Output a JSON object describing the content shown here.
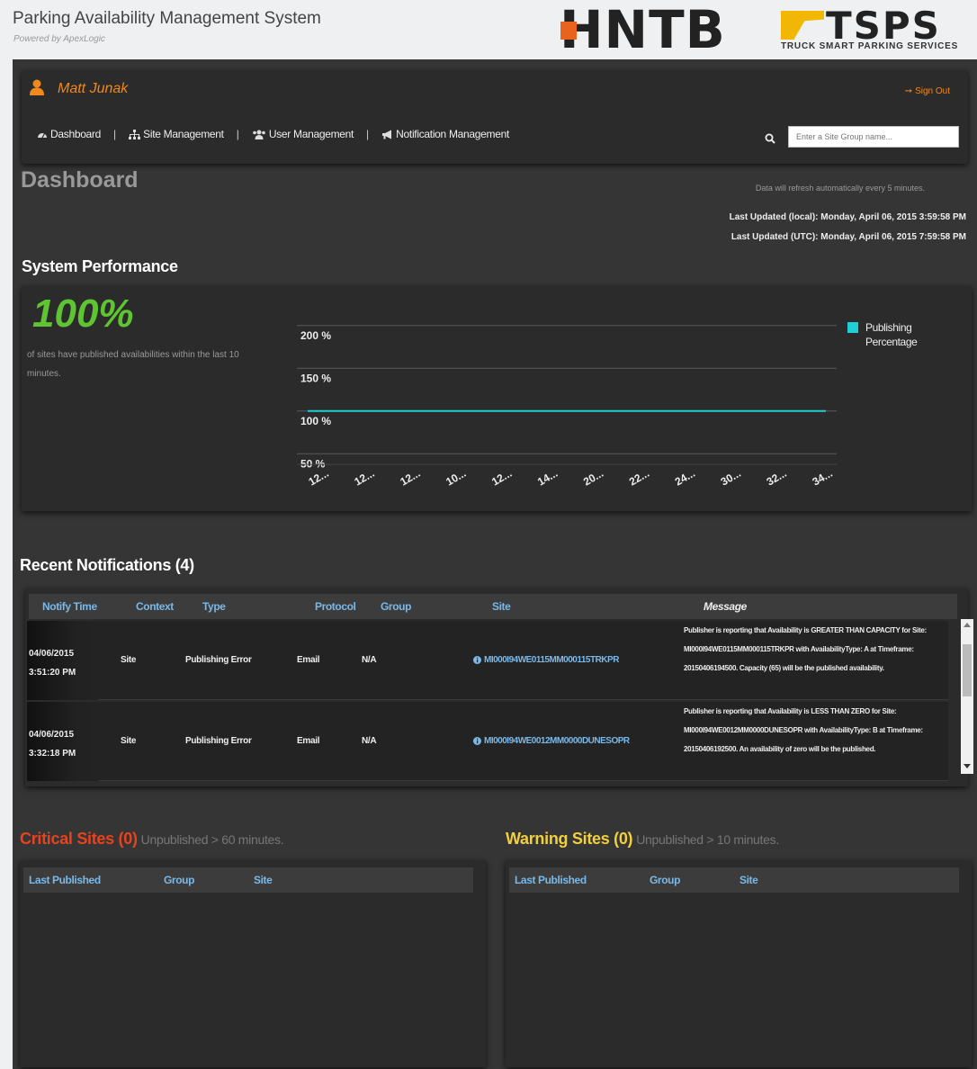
{
  "header": {
    "app_title": "Parking Availability Management System",
    "powered_by": "Powered by ApexLogic",
    "logo_hntb": "HNTB",
    "logo_tsps": "TSPS",
    "logo_tsps_sub": "TRUCK SMART PARKING SERVICES"
  },
  "user": {
    "name": "Matt Junak",
    "sign_out": "Sign Out",
    "icon": "user-icon"
  },
  "nav": {
    "items": [
      {
        "label": "Dashboard",
        "icon": "dashboard-icon"
      },
      {
        "label": "Site Management",
        "icon": "sitemap-icon"
      },
      {
        "label": "User Management",
        "icon": "users-icon"
      },
      {
        "label": "Notification Management",
        "icon": "bullhorn-icon"
      }
    ],
    "search_placeholder": "Enter a Site Group name..."
  },
  "page": {
    "title": "Dashboard",
    "refresh_note": "Data will refresh automatically every 5 minutes.",
    "last_updated_local": "Last Updated (local): Monday, April 06, 2015 3:59:58 PM",
    "last_updated_utc": "Last Updated (UTC): Monday, April 06, 2015 7:59:58 PM"
  },
  "performance": {
    "section_title": "System Performance",
    "percent": "100%",
    "description": "of sites have published availabilities within the last 10 minutes."
  },
  "chart_data": {
    "type": "line",
    "categories": [
      "12...",
      "12...",
      "12...",
      "10...",
      "12...",
      "14...",
      "20...",
      "22...",
      "24...",
      "30...",
      "32...",
      "34..."
    ],
    "series": [
      {
        "name": "Publishing Percentage",
        "values": [
          100,
          100,
          100,
          100,
          100,
          100,
          100,
          100,
          100,
          100,
          100,
          100
        ],
        "color": "#20cfd6"
      }
    ],
    "ytick_labels": [
      "200 %",
      "150 %",
      "100 %",
      "50 %"
    ],
    "yticks": [
      200,
      150,
      100,
      50
    ],
    "ylim": [
      25,
      225
    ],
    "legend_position": "right",
    "grid": true
  },
  "notifications": {
    "section_title": "Recent Notifications (4)",
    "columns": [
      "Notify Time",
      "Context",
      "Type",
      "Protocol",
      "Group",
      "Site",
      "Message"
    ],
    "rows": [
      {
        "date": "04/06/2015",
        "time": "3:51:20 PM",
        "context": "Site",
        "type": "Publishing Error",
        "protocol": "Email",
        "group": "N/A",
        "site": "MI000I94WE0115MM000115TRKPR",
        "message": "Publisher is reporting that Availability is GREATER THAN CAPACITY for Site: MI000I94WE0115MM000115TRKPR with AvailabilityType: A at Timeframe: 20150406194500. Capacity (65) will be the published availability."
      },
      {
        "date": "04/06/2015",
        "time": "3:32:18 PM",
        "context": "Site",
        "type": "Publishing Error",
        "protocol": "Email",
        "group": "N/A",
        "site": "MI000I94WE0012MM0000DUNESOPR",
        "message": "Publisher is reporting that Availability is LESS THAN ZERO for Site: MI000I94WE0012MM0000DUNESOPR with AvailabilityType: B at Timeframe: 20150406192500. An availability of zero will be the published."
      }
    ]
  },
  "critical": {
    "title": "Critical Sites (0)",
    "subtitle": "Unpublished > 60 minutes.",
    "columns": [
      "Last Published",
      "Group",
      "Site"
    ],
    "color": "#e8421e"
  },
  "warning": {
    "title": "Warning Sites (0)",
    "subtitle": "Unpublished > 10 minutes.",
    "columns": [
      "Last Published",
      "Group",
      "Site"
    ],
    "color": "#f2d03b"
  }
}
